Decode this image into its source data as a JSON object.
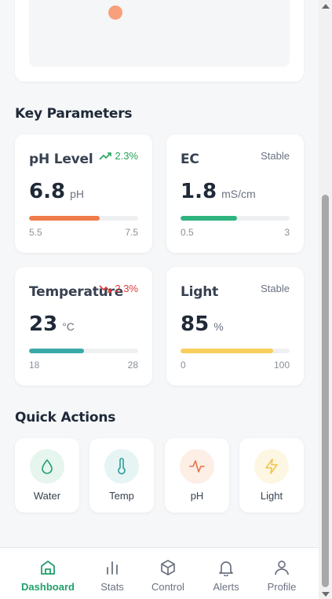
{
  "sections": {
    "key_parameters": "Key Parameters",
    "quick_actions": "Quick Actions"
  },
  "parameters": [
    {
      "name": "pH Level",
      "value": "6.8",
      "unit": "pH",
      "trend": "2.3%",
      "trend_dir": "up",
      "min": "5.5",
      "max": "7.5",
      "fill_fraction": 0.65,
      "color": "#f07c4a"
    },
    {
      "name": "EC",
      "value": "1.8",
      "unit": "mS/cm",
      "trend": "Stable",
      "trend_dir": "stable",
      "min": "0.5",
      "max": "3",
      "fill_fraction": 0.52,
      "color": "#2fb37f"
    },
    {
      "name": "Temperature",
      "value": "23",
      "unit": "°C",
      "trend": "2.3%",
      "trend_dir": "down",
      "min": "18",
      "max": "28",
      "fill_fraction": 0.5,
      "color": "#3aa9a9"
    },
    {
      "name": "Light",
      "value": "85",
      "unit": "%",
      "trend": "Stable",
      "trend_dir": "stable",
      "min": "0",
      "max": "100",
      "fill_fraction": 0.85,
      "color": "#f7cf5a"
    }
  ],
  "quick_actions": [
    {
      "label": "Water",
      "icon": "droplet-icon",
      "bg": "#e6f5ee",
      "color": "#22a06b"
    },
    {
      "label": "Temp",
      "icon": "thermometer-icon",
      "bg": "#e6f4f4",
      "color": "#2f9a9a"
    },
    {
      "label": "pH",
      "icon": "activity-icon",
      "bg": "#fdeee6",
      "color": "#e8744a"
    },
    {
      "label": "Light",
      "icon": "zap-icon",
      "bg": "#fdf6e3",
      "color": "#f2c44d"
    }
  ],
  "nav": [
    {
      "label": "Dashboard",
      "icon": "home-icon",
      "active": true
    },
    {
      "label": "Stats",
      "icon": "bar-chart-icon",
      "active": false
    },
    {
      "label": "Control",
      "icon": "box-icon",
      "active": false
    },
    {
      "label": "Alerts",
      "icon": "bell-icon",
      "active": false
    },
    {
      "label": "Profile",
      "icon": "user-icon",
      "active": false
    }
  ],
  "colors": {
    "accent": "#22a06b",
    "trend_up": "#22a35a",
    "trend_down": "#dc3b3b"
  }
}
